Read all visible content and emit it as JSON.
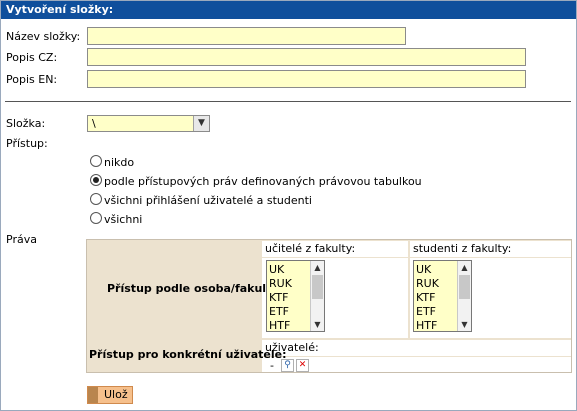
{
  "title": "Vytvoření složky:",
  "fields": {
    "nazev_label": "Název složky:",
    "popis_cz_label": "Popis CZ:",
    "popis_en_label": "Popis EN:",
    "nazev_value": "",
    "popis_cz_value": "",
    "popis_en_value": ""
  },
  "folder": {
    "label": "Složka:",
    "selected": "\\"
  },
  "access": {
    "label": "Přístup:",
    "options": [
      {
        "label": "nikdo",
        "selected": false
      },
      {
        "label": "podle přístupových práv definovaných právovou tabulkou",
        "selected": true
      },
      {
        "label": "všichni přihlášení uživatelé a studenti",
        "selected": false
      },
      {
        "label": "všichni",
        "selected": false
      }
    ]
  },
  "rights": {
    "label": "Práva",
    "teachers_header": "učitelé z fakulty:",
    "students_header": "studenti z fakulty:",
    "row1_label": "Přístup podle osoba/fakulta:",
    "row2_label": "Přístup pro konkrétní uživatele:",
    "users_header": "uživatelé:",
    "users_value": "-",
    "faculties": [
      "UK",
      "RUK",
      "KTF",
      "ETF",
      "HTF"
    ]
  },
  "icons": {
    "select_arrow": "chevron-down-icon",
    "search": "magnifier-icon",
    "delete": "close-icon"
  },
  "save_label": "Ulož"
}
